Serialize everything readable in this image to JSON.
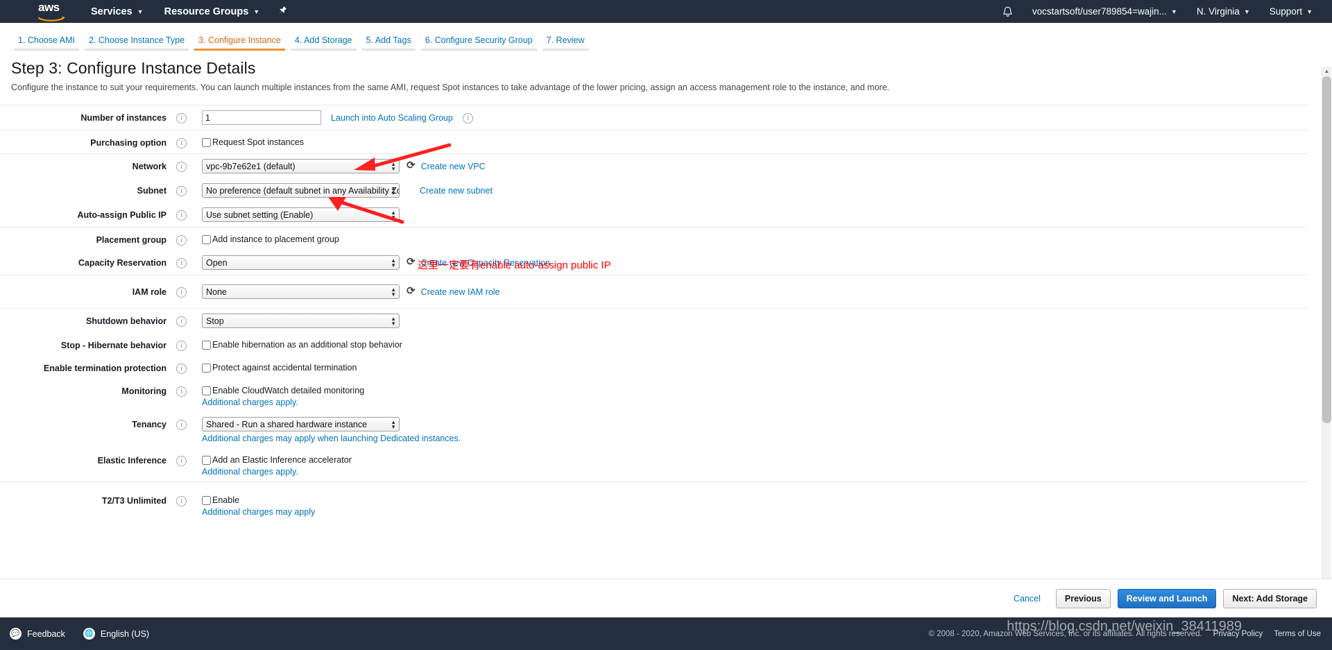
{
  "topnav": {
    "logo_text": "aws",
    "services_label": "Services",
    "resource_groups_label": "Resource Groups",
    "account_label": "vocstartsoft/user789854=wajin...",
    "region_label": "N. Virginia",
    "support_label": "Support"
  },
  "tabs": [
    {
      "label": "1. Choose AMI",
      "active": false
    },
    {
      "label": "2. Choose Instance Type",
      "active": false
    },
    {
      "label": "3. Configure Instance",
      "active": true
    },
    {
      "label": "4. Add Storage",
      "active": false
    },
    {
      "label": "5. Add Tags",
      "active": false
    },
    {
      "label": "6. Configure Security Group",
      "active": false
    },
    {
      "label": "7. Review",
      "active": false
    }
  ],
  "page": {
    "title": "Step 3: Configure Instance Details",
    "description": "Configure the instance to suit your requirements. You can launch multiple instances from the same AMI, request Spot instances to take advantage of the lower pricing, assign an access management role to the instance, and more."
  },
  "form": {
    "number_of_instances": {
      "label": "Number of instances",
      "value": "1",
      "link": "Launch into Auto Scaling Group"
    },
    "purchasing_option": {
      "label": "Purchasing option",
      "checkbox_label": "Request Spot instances",
      "checked": false
    },
    "network": {
      "label": "Network",
      "value": "vpc-9b7e62e1 (default)",
      "link": "Create new VPC"
    },
    "subnet": {
      "label": "Subnet",
      "value": "No preference (default subnet in any Availability Zone)",
      "link": "Create new subnet"
    },
    "auto_assign_public_ip": {
      "label": "Auto-assign Public IP",
      "value": "Use subnet setting (Enable)"
    },
    "placement_group": {
      "label": "Placement group",
      "checkbox_label": "Add instance to placement group",
      "checked": false
    },
    "capacity_reservation": {
      "label": "Capacity Reservation",
      "value": "Open",
      "link": "Create new Capacity Reservation"
    },
    "iam_role": {
      "label": "IAM role",
      "value": "None",
      "link": "Create new IAM role"
    },
    "shutdown_behavior": {
      "label": "Shutdown behavior",
      "value": "Stop"
    },
    "hibernate_behavior": {
      "label": "Stop - Hibernate behavior",
      "checkbox_label": "Enable hibernation as an additional stop behavior",
      "checked": false
    },
    "termination_protection": {
      "label": "Enable termination protection",
      "checkbox_label": "Protect against accidental termination",
      "checked": false
    },
    "monitoring": {
      "label": "Monitoring",
      "checkbox_label": "Enable CloudWatch detailed monitoring",
      "checked": false,
      "sub_link": "Additional charges apply."
    },
    "tenancy": {
      "label": "Tenancy",
      "value": "Shared - Run a shared hardware instance",
      "sub_link": "Additional charges may apply when launching Dedicated instances."
    },
    "elastic_inference": {
      "label": "Elastic Inference",
      "checkbox_label": "Add an Elastic Inference accelerator",
      "checked": false,
      "sub_link": "Additional charges apply."
    },
    "t2_t3_unlimited": {
      "label": "T2/T3 Unlimited",
      "checkbox_label": "Enable",
      "checked": false,
      "sub_link": "Additional charges may apply"
    }
  },
  "annotation": {
    "text": "这里一定要有enable auto-assign public IP",
    "color": "#ff0000"
  },
  "footer": {
    "cancel": "Cancel",
    "previous": "Previous",
    "review_and_launch": "Review and Launch",
    "next": "Next: Add Storage"
  },
  "bottombar": {
    "feedback": "Feedback",
    "language": "English (US)",
    "copyright": "© 2008 - 2020, Amazon Web Services, Inc. or its affiliates. All rights reserved.",
    "privacy": "Privacy Policy",
    "terms": "Terms of Use",
    "watermark": "https://blog.csdn.net/weixin_38411989"
  }
}
